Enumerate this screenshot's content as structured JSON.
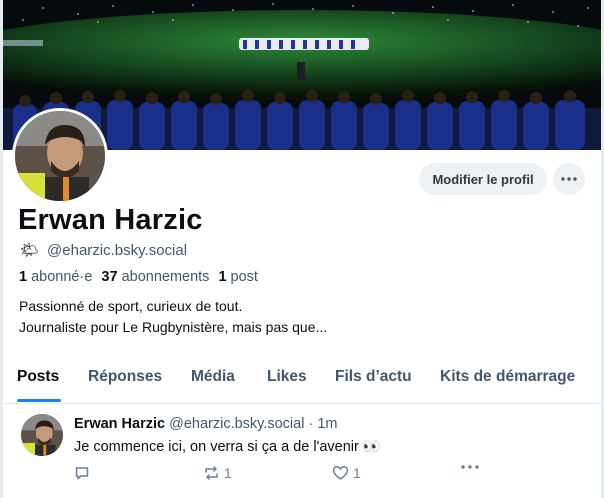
{
  "profile": {
    "display_name": "Erwan Harzic",
    "handle_emoji": "🌤",
    "handle": "@eharzic.bsky.social",
    "followers_count": "1",
    "followers_label": "abonné·e",
    "following_count": "37",
    "following_label": "abonnements",
    "posts_count": "1",
    "posts_label": "post",
    "bio_line1": "Passionné de sport, curieux de tout.",
    "bio_line2": "Journaliste pour Le Rugbynistère, mais pas que...",
    "edit_button": "Modifier le profil",
    "more_icon": "ellipsis-icon"
  },
  "tabs": [
    {
      "label": "Posts",
      "active": true
    },
    {
      "label": "Réponses",
      "active": false
    },
    {
      "label": "Média",
      "active": false
    },
    {
      "label": "Likes",
      "active": false
    },
    {
      "label": "Fils d’actu",
      "active": false
    },
    {
      "label": "Kits de démarrage",
      "active": false
    }
  ],
  "post": {
    "author": "Erwan Harzic",
    "handle": "@eharzic.bsky.social",
    "separator": "·",
    "time": "1m",
    "text": "Je commence ici, on verra si ça a de l'avenir 👀",
    "reply_count": "",
    "repost_count": "1",
    "like_count": "1"
  },
  "colors": {
    "accent": "#1083fe",
    "muted_text": "#42576c",
    "button_bg": "#eef1f3"
  }
}
